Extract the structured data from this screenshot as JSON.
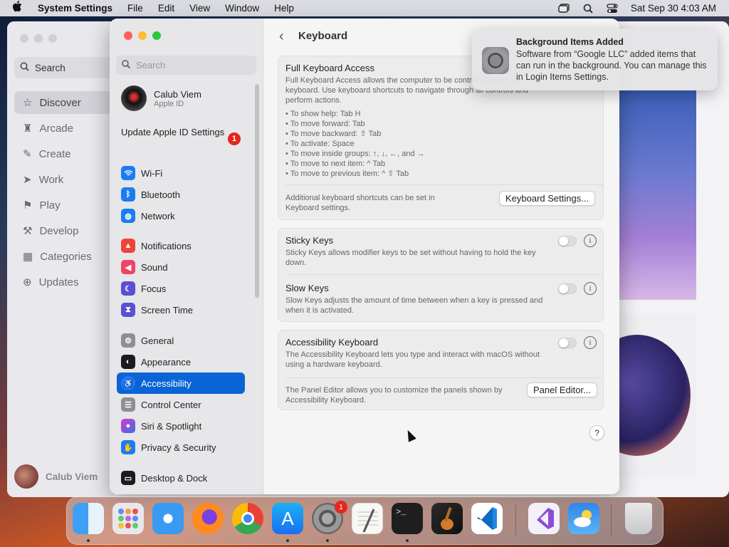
{
  "menubar": {
    "app_name": "System Settings",
    "items": [
      "File",
      "Edit",
      "View",
      "Window",
      "Help"
    ],
    "datetime": "Sat Sep 30  4:03 AM"
  },
  "appstore": {
    "search_placeholder": "Search",
    "nav": [
      "Discover",
      "Arcade",
      "Create",
      "Work",
      "Play",
      "Develop",
      "Categories",
      "Updates"
    ],
    "user": "Calub Viem"
  },
  "settings": {
    "search_placeholder": "Search",
    "profile": {
      "name": "Calub Viem",
      "subtitle": "Apple ID"
    },
    "update_label": "Update Apple ID Settings",
    "update_badge": "1",
    "nav_groups": [
      [
        "Wi-Fi",
        "Bluetooth",
        "Network"
      ],
      [
        "Notifications",
        "Sound",
        "Focus",
        "Screen Time"
      ],
      [
        "General",
        "Appearance",
        "Accessibility",
        "Control Center",
        "Siri & Spotlight",
        "Privacy & Security"
      ],
      [
        "Desktop & Dock"
      ]
    ],
    "selected": "Accessibility",
    "detail": {
      "title": "Keyboard",
      "fka": {
        "title": "Full Keyboard Access",
        "desc": "Full Keyboard Access allows the computer to be controlled using the keyboard. Use keyboard shortcuts to navigate through all controls and perform actions.",
        "tips": [
          "• To show help: Tab H",
          "• To move forward: Tab",
          "• To move backward: ⇧ Tab",
          "• To activate: Space",
          "• To move inside groups: ↑, ↓, ←, and →",
          "• To move to next item: ^ Tab",
          "• To move to previous item: ^ ⇧ Tab"
        ],
        "extra": "Additional keyboard shortcuts can be set in Keyboard settings.",
        "button": "Keyboard Settings..."
      },
      "sticky": {
        "title": "Sticky Keys",
        "desc": "Sticky Keys allows modifier keys to be set without having to hold the key down."
      },
      "slow": {
        "title": "Slow Keys",
        "desc": "Slow Keys adjusts the amount of time between when a key is pressed and when it is activated."
      },
      "acc_kb": {
        "title": "Accessibility Keyboard",
        "desc": "The Accessibility Keyboard lets you type and interact with macOS without using a hardware keyboard."
      },
      "panel": {
        "desc": "The Panel Editor allows you to customize the panels shown by Accessibility Keyboard.",
        "button": "Panel Editor..."
      },
      "help": "?"
    }
  },
  "notification": {
    "title": "Background Items Added",
    "body": "Software from “Google LLC” added items that can run in the background. You can manage this in Login Items Settings."
  },
  "dock": {
    "apps": [
      "finder",
      "launchpad",
      "safari",
      "firefox",
      "chrome",
      "app-store",
      "system-settings",
      "textedit",
      "terminal",
      "garageband",
      "vscode",
      "visual-studio",
      "weather",
      "trash"
    ],
    "settings_badge": "1"
  },
  "colors": {
    "accent": "#0a64d6",
    "badge": "#e5261f"
  }
}
